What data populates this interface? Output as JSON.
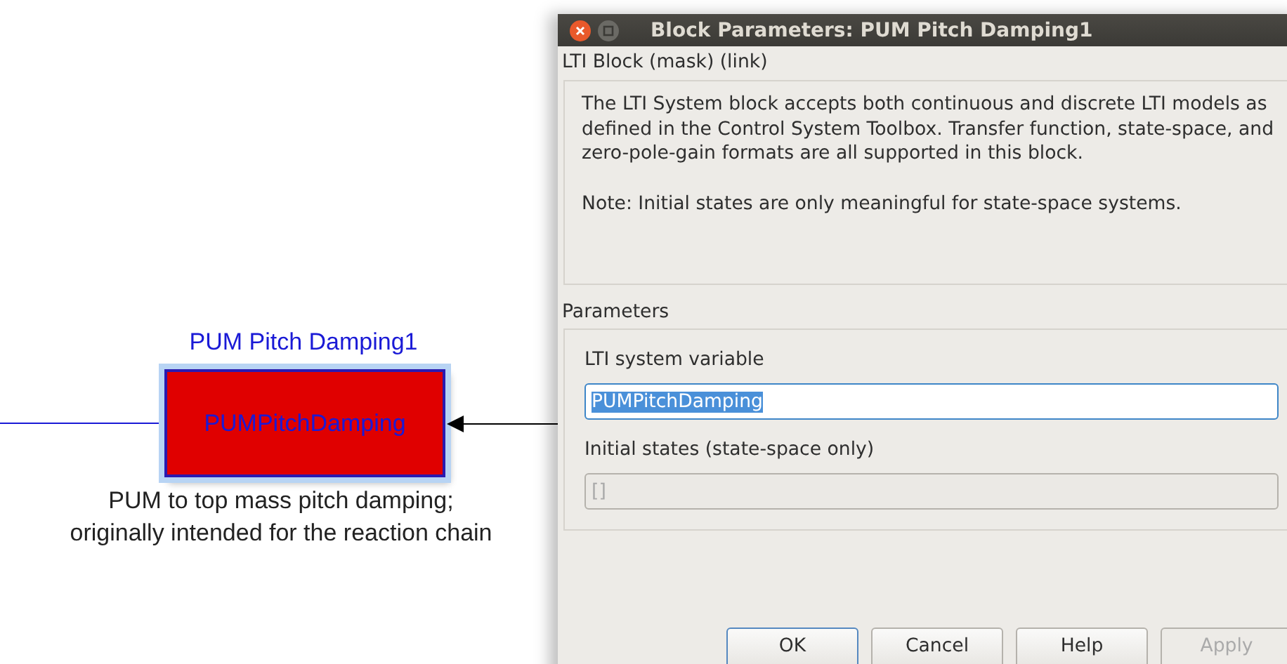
{
  "diagram": {
    "block_name": "PUM Pitch Damping1",
    "block_text": "PUMPitchDamping",
    "caption": [
      "PUM to top mass pitch damping;",
      "originally intended for the reaction chain"
    ]
  },
  "dialog": {
    "title": "Block Parameters: PUM Pitch Damping1",
    "header": "LTI Block (mask) (link)",
    "description": [
      "The LTI System block accepts both continuous and discrete LTI models as defined in the Control System Toolbox. Transfer function, state-space, and zero-pole-gain formats are all supported in this block.",
      "Note: Initial states are only meaningful for state-space systems."
    ],
    "parameters_title": "Parameters",
    "fields": [
      {
        "label": "LTI system variable",
        "value": "PUMPitchDamping",
        "selected": true,
        "disabled": false
      },
      {
        "label": "Initial states (state-space only)",
        "value": "[]",
        "selected": false,
        "disabled": true
      }
    ],
    "buttons": [
      {
        "label": "OK",
        "disabled": false
      },
      {
        "label": "Cancel",
        "disabled": false
      },
      {
        "label": "Help",
        "disabled": false
      },
      {
        "label": "Apply",
        "disabled": true
      }
    ]
  }
}
